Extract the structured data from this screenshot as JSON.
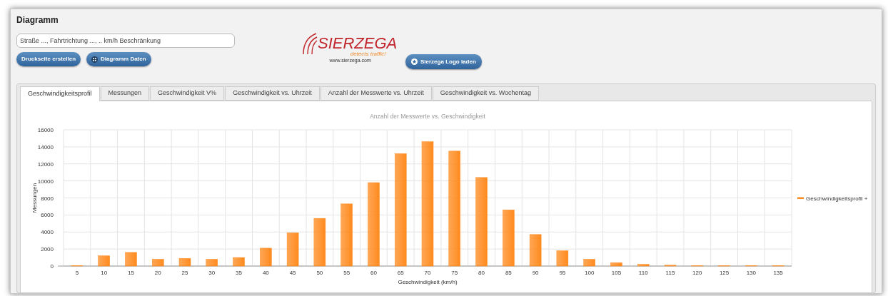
{
  "panel": {
    "title": "Diagramm"
  },
  "location_field": {
    "value": "Straße ..., Fahrtrichtung ..., .. km/h Beschränkung"
  },
  "buttons": [
    {
      "label": "Druckseite erstellen",
      "kind": "plain"
    },
    {
      "label": "Diagramm Daten",
      "kind": "grid"
    }
  ],
  "logo": {
    "name": "SIERZEGA",
    "tagline": "detects traffic!",
    "url": "www.sierzega.com"
  },
  "logo_button": {
    "label": "Sierzega Logo laden"
  },
  "tabs": [
    {
      "label": "Geschwindigkeitsprofil",
      "selected": true
    },
    {
      "label": "Messungen",
      "selected": false
    },
    {
      "label": "Geschwindigkeit V%",
      "selected": false
    },
    {
      "label": "Geschwindigkeit vs. Uhrzeit",
      "selected": false
    },
    {
      "label": "Anzahl der Messwerte vs. Uhrzeit",
      "selected": false
    },
    {
      "label": "Geschwindigkeit vs. Wochentag",
      "selected": false
    }
  ],
  "chart_data": {
    "type": "bar",
    "title": "Anzahl der Messwerte vs. Geschwindigkeit",
    "xlabel": "Geschwindigkeit (km/h)",
    "ylabel": "Messungen",
    "categories": [
      "5",
      "10",
      "15",
      "20",
      "25",
      "30",
      "35",
      "40",
      "45",
      "50",
      "55",
      "60",
      "65",
      "70",
      "75",
      "80",
      "85",
      "90",
      "95",
      "100",
      "105",
      "110",
      "115",
      "120",
      "125",
      "130",
      "135"
    ],
    "series": [
      {
        "name": "Geschwindigkeitsprofil +",
        "color": "#ff8a1e",
        "values": [
          0,
          1200,
          1600,
          800,
          900,
          800,
          1000,
          2100,
          3900,
          5600,
          7300,
          9800,
          13200,
          14600,
          13500,
          10400,
          6600,
          3700,
          1800,
          800,
          400,
          200,
          100,
          0,
          0,
          0,
          0
        ]
      }
    ],
    "grid": true,
    "ylim": [
      0,
      16000
    ],
    "yticks": [
      0,
      2000,
      4000,
      6000,
      8000,
      10000,
      12000,
      14000,
      16000
    ]
  }
}
